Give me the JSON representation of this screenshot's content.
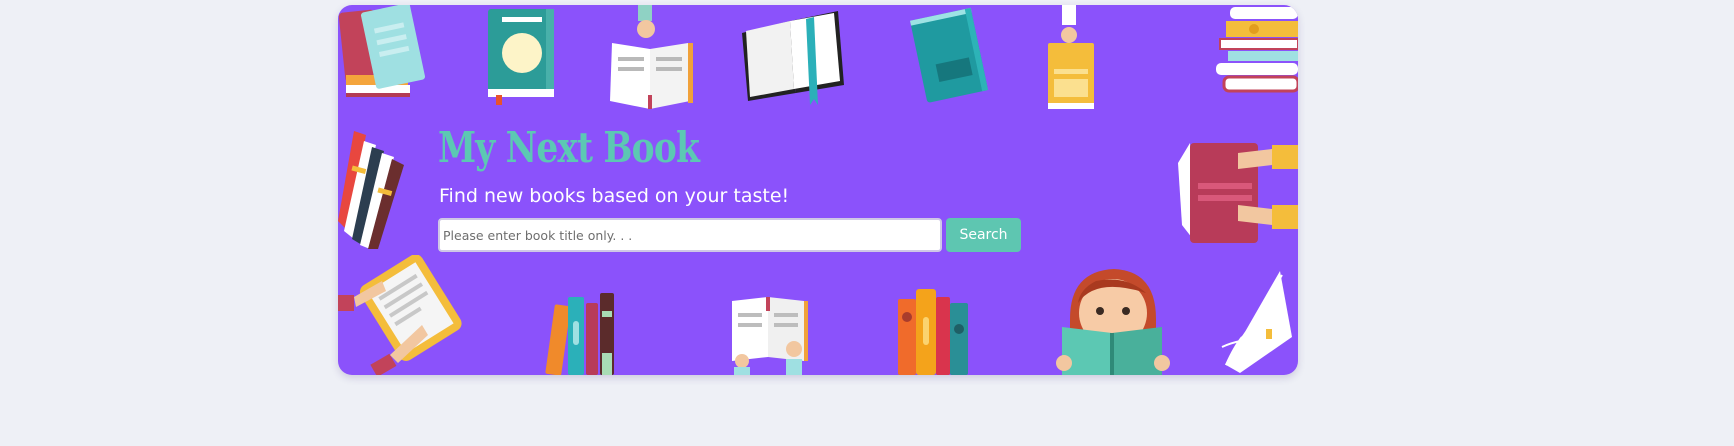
{
  "hero": {
    "title": "My Next Book",
    "subtitle": "Find new books based on your taste!"
  },
  "search": {
    "placeholder": "Please enter book title only. . .",
    "value": "",
    "button_label": "Search"
  },
  "colors": {
    "page_background": "#eef0f6",
    "hero_background": "#8b52fb",
    "accent_teal": "#5ec6b1",
    "title_teal": "#5cc8b3"
  },
  "decorations": [
    "stacked-books-icon",
    "teal-book-with-moon-icon",
    "hand-holding-open-book-icon",
    "open-book-with-bookmark-icon",
    "teal-book-icon",
    "hand-holding-yellow-book-icon",
    "book-stack-icon",
    "fanned-book-spines-icon",
    "hands-holding-red-book-icon",
    "hands-holding-tablet-icon",
    "bookshelf-books-icon",
    "hands-holding-open-book-icon",
    "standing-books-icon",
    "girl-reading-book-icon",
    "flipping-pages-book-icon"
  ]
}
